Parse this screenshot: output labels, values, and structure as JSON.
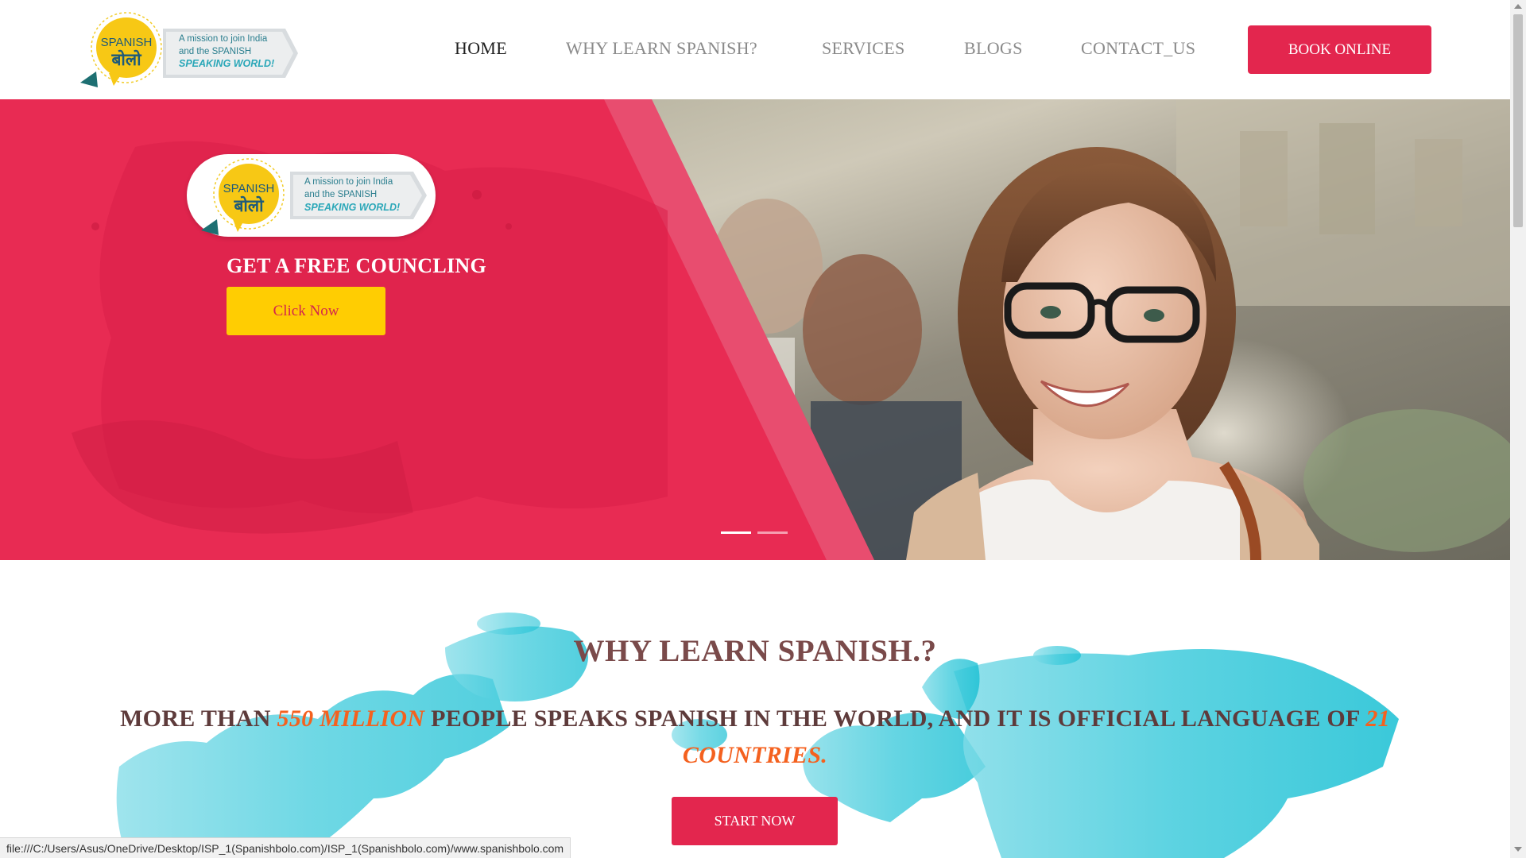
{
  "brand": {
    "logo_word_1": "SPANISH",
    "logo_word_2": "बोलो",
    "tagline_line_1": "A mission to join India",
    "tagline_line_2": "and the SPANISH",
    "tagline_line_3": "SPEAKING WORLD!"
  },
  "nav": {
    "items": [
      {
        "label": "HOME",
        "active": true
      },
      {
        "label": "WHY LEARN SPANISH?",
        "active": false
      },
      {
        "label": "SERVICES",
        "active": false
      },
      {
        "label": "BLOGS",
        "active": false
      },
      {
        "label": "CONTACT_US",
        "active": false
      }
    ],
    "book_label": "BOOK ONLINE"
  },
  "hero": {
    "heading": "GET A FREE COUNCLING",
    "cta_label": "Click Now",
    "slides_total": 2,
    "active_slide": 1
  },
  "why": {
    "title": "WHY LEARN SPANISH.?",
    "text_1": "MORE THAN ",
    "highlight_1": "550 MILLION",
    "text_2": " PEOPLE SPEAKS SPANISH IN THE WORLD, AND IT IS OFFICIAL LANGUAGE OF ",
    "highlight_2": "21 COUNTRIES.",
    "button_label": "START NOW"
  },
  "status_bar": {
    "url": "file:///C:/Users/Asus/OneDrive/Desktop/ISP_1(Spanishbolo.com)/ISP_1(Spanishbolo.com)/www.spanishbolo.com"
  },
  "colors": {
    "accent_red": "#e3264e",
    "cta_yellow": "#ffcd02",
    "highlight_orange": "#f4611f",
    "map_teal": "#2fc6d8"
  }
}
